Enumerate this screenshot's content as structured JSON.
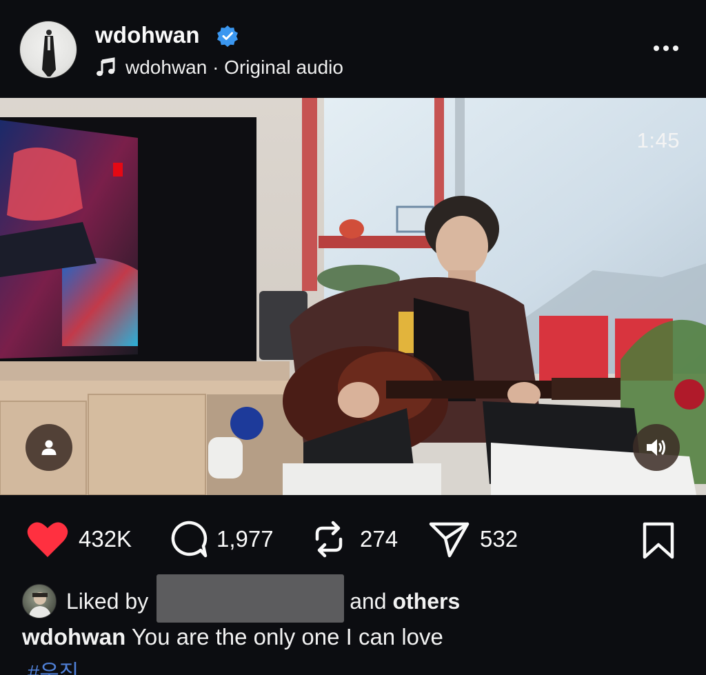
{
  "post": {
    "username": "wdohwan",
    "verified": true,
    "audio": "wdohwan · Original audio",
    "video_duration": "1:45"
  },
  "icons": {
    "verified": "verified-badge-icon",
    "audio": "music-note-icon",
    "more": "more-options-icon",
    "user_tag": "user-tag-icon",
    "sound": "speaker-icon",
    "like": "heart-icon",
    "comment": "comment-icon",
    "repost": "repost-icon",
    "share": "send-icon",
    "save": "bookmark-icon"
  },
  "stats": {
    "likes": "432K",
    "comments": "1,977",
    "reposts": "274",
    "shares": "532"
  },
  "likes_line": {
    "prefix": "Liked by",
    "middle": "and",
    "others": "others"
  },
  "caption": {
    "username": "wdohwan",
    "text": "You are the only one I can love",
    "hashtag": "#우진"
  },
  "colors": {
    "background": "#0c0d11",
    "like_red": "#ff3040",
    "verified_blue": "#3b97f0",
    "hashtag_blue": "#4f7fd6"
  }
}
